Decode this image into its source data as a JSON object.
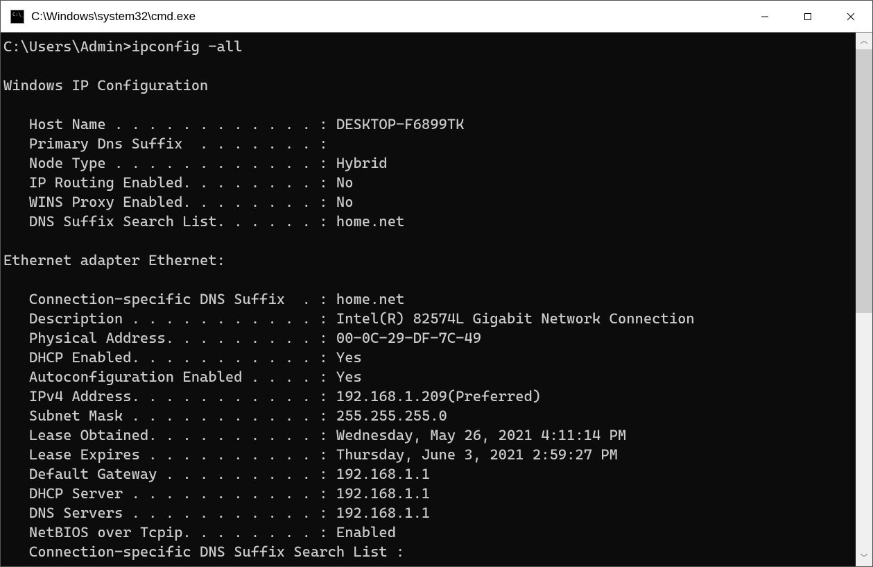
{
  "window": {
    "title": "C:\\Windows\\system32\\cmd.exe"
  },
  "terminal": {
    "prompt": "C:\\Users\\Admin>",
    "command": "ipconfig -all",
    "header": "Windows IP Configuration",
    "config": [
      {
        "label": "Host Name . . . . . . . . . . . . :",
        "value": " DESKTOP-F6899TK"
      },
      {
        "label": "Primary Dns Suffix  . . . . . . . :",
        "value": ""
      },
      {
        "label": "Node Type . . . . . . . . . . . . :",
        "value": " Hybrid"
      },
      {
        "label": "IP Routing Enabled. . . . . . . . :",
        "value": " No"
      },
      {
        "label": "WINS Proxy Enabled. . . . . . . . :",
        "value": " No"
      },
      {
        "label": "DNS Suffix Search List. . . . . . :",
        "value": " home.net"
      }
    ],
    "adapter_header": "Ethernet adapter Ethernet:",
    "adapter": [
      {
        "label": "Connection-specific DNS Suffix  . :",
        "value": " home.net"
      },
      {
        "label": "Description . . . . . . . . . . . :",
        "value": " Intel(R) 82574L Gigabit Network Connection"
      },
      {
        "label": "Physical Address. . . . . . . . . :",
        "value": " 00-0C-29-DF-7C-49"
      },
      {
        "label": "DHCP Enabled. . . . . . . . . . . :",
        "value": " Yes"
      },
      {
        "label": "Autoconfiguration Enabled . . . . :",
        "value": " Yes"
      },
      {
        "label": "IPv4 Address. . . . . . . . . . . :",
        "value": " 192.168.1.209(Preferred)"
      },
      {
        "label": "Subnet Mask . . . . . . . . . . . :",
        "value": " 255.255.255.0"
      },
      {
        "label": "Lease Obtained. . . . . . . . . . :",
        "value": " Wednesday, May 26, 2021 4:11:14 PM"
      },
      {
        "label": "Lease Expires . . . . . . . . . . :",
        "value": " Thursday, June 3, 2021 2:59:27 PM"
      },
      {
        "label": "Default Gateway . . . . . . . . . :",
        "value": " 192.168.1.1"
      },
      {
        "label": "DHCP Server . . . . . . . . . . . :",
        "value": " 192.168.1.1"
      },
      {
        "label": "DNS Servers . . . . . . . . . . . :",
        "value": " 192.168.1.1"
      },
      {
        "label": "NetBIOS over Tcpip. . . . . . . . :",
        "value": " Enabled"
      },
      {
        "label": "Connection-specific DNS Suffix Search List :",
        "value": ""
      }
    ]
  }
}
